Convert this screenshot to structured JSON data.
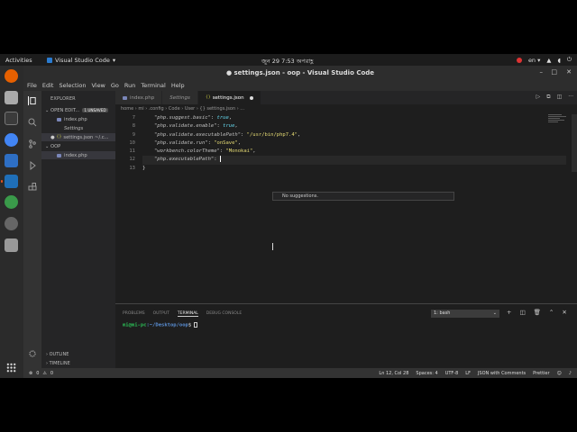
{
  "topbar": {
    "activities": "Activities",
    "app_name": "Visual Studio Code",
    "clock": "জুন 29  7:53 অপরাহ্ণ",
    "lang": "en"
  },
  "window": {
    "title": "● settings.json - oop - Visual Studio Code"
  },
  "menu": [
    "File",
    "Edit",
    "Selection",
    "View",
    "Go",
    "Run",
    "Terminal",
    "Help"
  ],
  "sidebar": {
    "header": "EXPLORER",
    "open_editors_label": "OPEN EDIT...",
    "unsaved_badge": "1 UNSAVED",
    "open_editors": [
      "index.php",
      "Settings",
      "settings.json ~/.c..."
    ],
    "folder_label": "OOP",
    "folder_files": [
      "index.php"
    ],
    "outline": "OUTLINE",
    "timeline": "TIMELINE"
  },
  "tabs": [
    "index.php",
    "Settings",
    "settings.json"
  ],
  "breadcrumb": "home › mi › .config › Code › User › {} settings.json › ...",
  "code": {
    "line_numbers": [
      "7",
      "8",
      "9",
      "10",
      "11",
      "12",
      "13"
    ],
    "lines": [
      {
        "key": "\"php.suggest.basic\"",
        "sep": ": ",
        "val": "true",
        "vtype": "kw",
        "end": ","
      },
      {
        "key": "\"php.validate.enable\"",
        "sep": ": ",
        "val": "true",
        "vtype": "kw",
        "end": ","
      },
      {
        "key": "\"php.validate.executablePath\"",
        "sep": ": ",
        "val": "\"/usr/bin/php7.4\"",
        "vtype": "s",
        "end": ","
      },
      {
        "key": "\"php.validate.run\"",
        "sep": ": ",
        "val": "\"onSave\"",
        "vtype": "s",
        "end": ","
      },
      {
        "key": "\"workbench.colorTheme\"",
        "sep": ": ",
        "val": "\"Monokai\"",
        "vtype": "s",
        "end": ","
      },
      {
        "key": "\"php.executablePath\"",
        "sep": ": ",
        "val": "",
        "vtype": "s",
        "end": ""
      },
      {
        "key": "",
        "sep": "",
        "val": "}",
        "vtype": "p",
        "end": ""
      }
    ],
    "suggestion": "No suggestions."
  },
  "panel": {
    "tabs": [
      "PROBLEMS",
      "OUTPUT",
      "TERMINAL",
      "DEBUG CONSOLE"
    ],
    "active_tab": "TERMINAL",
    "terminal_select": "1: bash",
    "prompt_user": "mi@mi-pc",
    "prompt_path": ":~/Desktop/oop",
    "prompt_symbol": "$"
  },
  "status": {
    "errors": "0",
    "warnings": "0",
    "position": "Ln 12, Col 28",
    "spaces": "Spaces: 4",
    "encoding": "UTF-8",
    "eol": "LF",
    "language": "JSON with Comments",
    "prettier": "Prettier"
  },
  "colors": {
    "accent": "#007acc",
    "editor_bg": "#1e1e1e",
    "sidebar_bg": "#252526",
    "activitybar_bg": "#333333",
    "ubuntu_orange": "#e95420"
  }
}
